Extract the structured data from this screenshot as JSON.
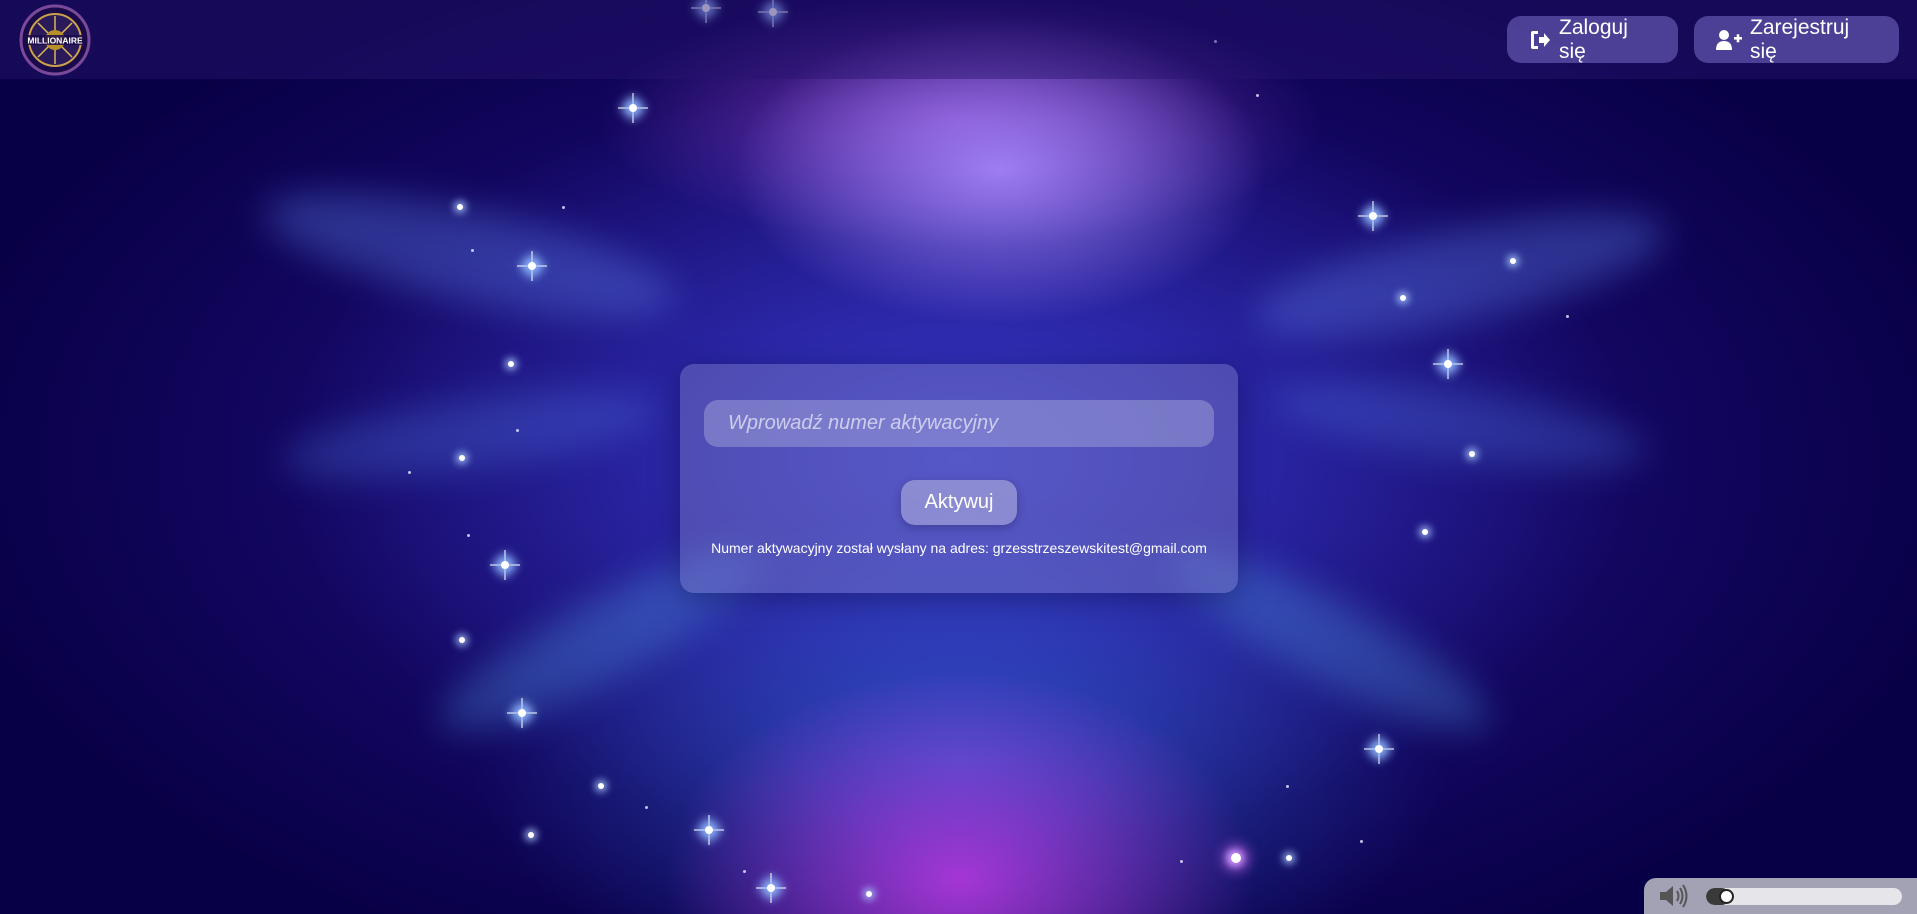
{
  "header": {
    "logo_icon": "millionaire-logo-icon",
    "login_label": "Zaloguj się",
    "login_icon": "sign-in-icon",
    "register_label": "Zarejestruj się",
    "register_icon": "user-plus-icon"
  },
  "activation": {
    "input_value": "",
    "input_placeholder": "Wprowadź numer aktywacyjny",
    "button_label": "Aktywuj",
    "info_text": "Numer aktywacyjny został wysłany na adres: grzesstrzeszewskitest@gmail.com"
  },
  "volume": {
    "icon": "volume-icon",
    "level": 0.06
  },
  "colors": {
    "background": "#0a0050",
    "accent": "#7a6ad0"
  }
}
